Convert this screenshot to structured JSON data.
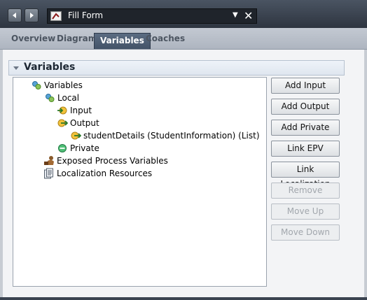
{
  "window": {
    "title": "Fill Form"
  },
  "tabs": [
    {
      "label": "Overview",
      "active": false
    },
    {
      "label": "Diagram",
      "active": false
    },
    {
      "label": "Variables",
      "active": true
    },
    {
      "label": "Coaches",
      "active": false
    }
  ],
  "section": {
    "title": "Variables"
  },
  "tree": {
    "root": "Variables",
    "local": "Local",
    "input": "Input",
    "output": "Output",
    "output_child": "studentDetails (StudentInformation) (List)",
    "private": "Private",
    "epv": "Exposed Process Variables",
    "localization": "Localization Resources"
  },
  "buttons": {
    "add_input": "Add Input",
    "add_output": "Add Output",
    "add_private": "Add Private",
    "link_epv": "Link EPV",
    "link_localization": "Link Localization",
    "remove": "Remove",
    "move_up": "Move Up",
    "move_down": "Move Down"
  },
  "colors": {
    "title_bar": "#2e3540",
    "active_tab": "#435368",
    "input_icon": "#e0a21a",
    "private_icon": "#3fa463"
  }
}
